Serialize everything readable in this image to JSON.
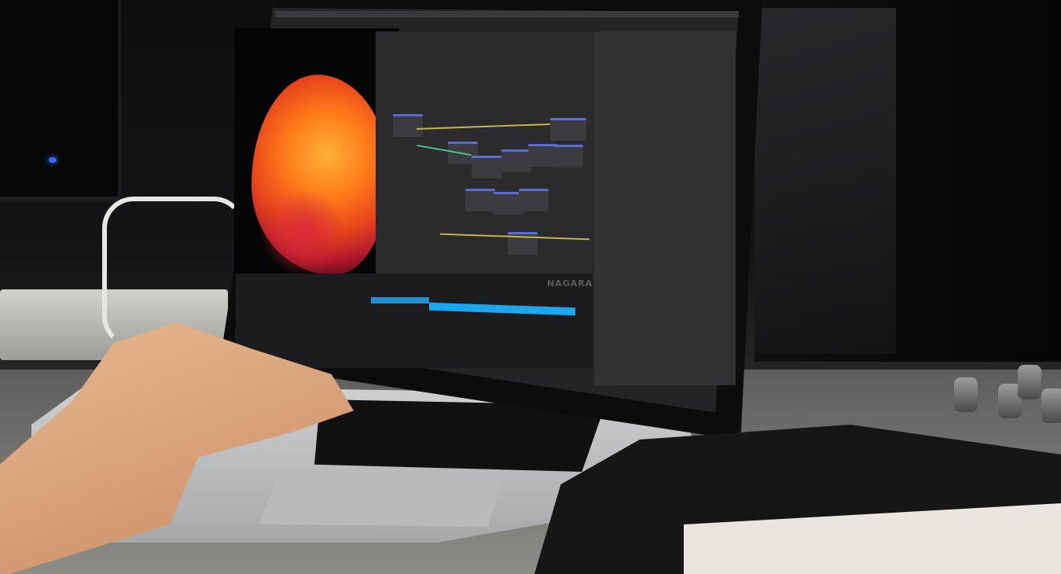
{
  "scene": {
    "watermark_text": "NAGARA",
    "colors": {
      "fire_core": "#ffb238",
      "fire_outer": "#e8441b",
      "timeline_accent": "#1aa7ef",
      "ui_background": "#242426",
      "node_header": "#5a6ad6",
      "wire": "#c8b448",
      "led": "#2f6bff"
    }
  }
}
